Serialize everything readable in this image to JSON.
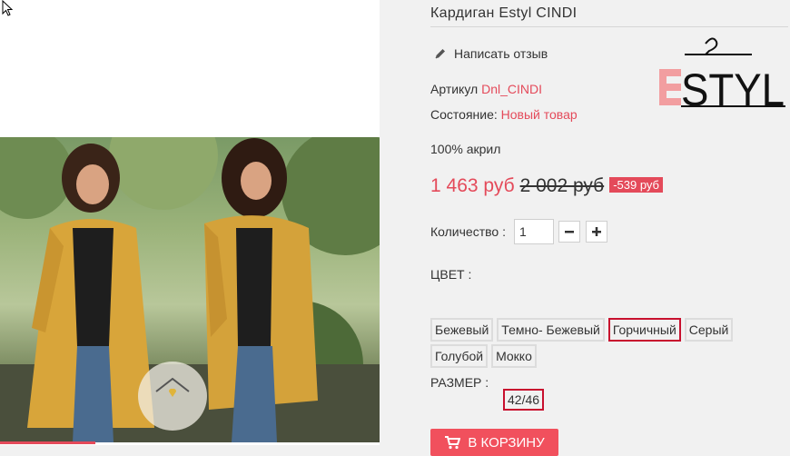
{
  "product": {
    "title": "Кардиган Estyl CINDI",
    "review_link": "Написать отзыв",
    "sku_label": "Артикул",
    "sku_value": "Dnl_CINDI",
    "condition_label": "Состояние:",
    "condition_value": "Новый товар",
    "material": "100% акрил",
    "price_new": "1 463 руб",
    "price_old": "2 002 руб",
    "discount": "-539 руб",
    "quantity_label": "Количество :",
    "quantity_value": "1",
    "qty_minus_symbol": "−",
    "qty_plus_symbol": "+",
    "color_label": "ЦВЕТ :",
    "colors": [
      "Бежевый",
      "Темно- Бежевый",
      "Горчичный",
      "Серый",
      "Голубой",
      "Мокко"
    ],
    "selected_color": "Горчичный",
    "size_label": "РАЗМЕР :",
    "size_value": "42/46",
    "cart_button": "В КОРЗИНУ"
  },
  "brand": {
    "logo_text": "ESTYL"
  },
  "colors": {
    "accent": "#e44a5a",
    "selected_border": "#c8102e",
    "background": "#f1f1f1",
    "cart_button": "#f1505d"
  },
  "icons": {
    "review": "pencil-icon",
    "cart": "cart-icon",
    "minus": "minus-icon",
    "plus": "plus-icon"
  }
}
